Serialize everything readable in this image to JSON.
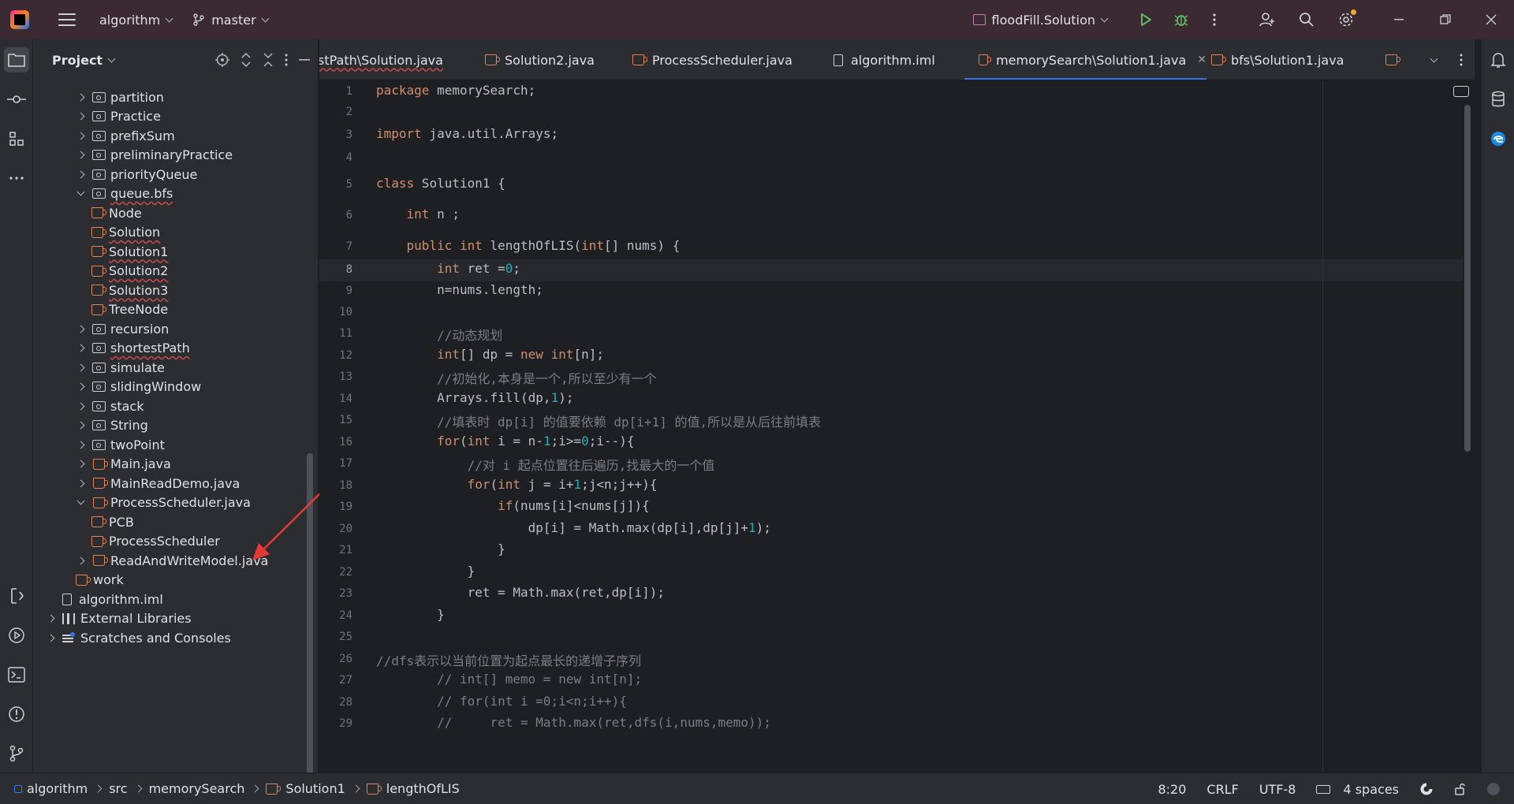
{
  "titlebar": {
    "project": "algorithm",
    "branch": "master",
    "run_config": "floodFill.Solution"
  },
  "project_panel": {
    "title": "Project",
    "tree": [
      {
        "label": "partition",
        "type": "folder",
        "depth": 1,
        "state": "collapsed",
        "error": false
      },
      {
        "label": "Practice",
        "type": "folder",
        "depth": 1,
        "state": "collapsed",
        "error": false
      },
      {
        "label": "prefixSum",
        "type": "folder",
        "depth": 1,
        "state": "collapsed",
        "error": false
      },
      {
        "label": "preliminaryPractice",
        "type": "folder",
        "depth": 1,
        "state": "collapsed",
        "error": false
      },
      {
        "label": "priorityQueue",
        "type": "folder",
        "depth": 1,
        "state": "collapsed",
        "error": false
      },
      {
        "label": "queue.bfs",
        "type": "folder",
        "depth": 1,
        "state": "expanded",
        "error": true
      },
      {
        "label": "Node",
        "type": "class",
        "depth": 2,
        "state": "leaf",
        "error": false
      },
      {
        "label": "Solution",
        "type": "class",
        "depth": 2,
        "state": "leaf",
        "error": true
      },
      {
        "label": "Solution1",
        "type": "class",
        "depth": 2,
        "state": "leaf",
        "error": true
      },
      {
        "label": "Solution2",
        "type": "class",
        "depth": 2,
        "state": "leaf",
        "error": true
      },
      {
        "label": "Solution3",
        "type": "class",
        "depth": 2,
        "state": "leaf",
        "error": true
      },
      {
        "label": "TreeNode",
        "type": "class",
        "depth": 2,
        "state": "leaf",
        "error": false
      },
      {
        "label": "recursion",
        "type": "folder",
        "depth": 1,
        "state": "collapsed",
        "error": false
      },
      {
        "label": "shortestPath",
        "type": "folder",
        "depth": 1,
        "state": "collapsed",
        "error": true
      },
      {
        "label": "simulate",
        "type": "folder",
        "depth": 1,
        "state": "collapsed",
        "error": false
      },
      {
        "label": "slidingWindow",
        "type": "folder",
        "depth": 1,
        "state": "collapsed",
        "error": false
      },
      {
        "label": "stack",
        "type": "folder",
        "depth": 1,
        "state": "collapsed",
        "error": false
      },
      {
        "label": "String",
        "type": "folder",
        "depth": 1,
        "state": "collapsed",
        "error": false
      },
      {
        "label": "twoPoint",
        "type": "folder",
        "depth": 1,
        "state": "collapsed",
        "error": false
      },
      {
        "label": "Main.java",
        "type": "class",
        "depth": 1,
        "state": "collapsed",
        "error": false
      },
      {
        "label": "MainReadDemo.java",
        "type": "class",
        "depth": 1,
        "state": "collapsed",
        "error": false
      },
      {
        "label": "ProcessScheduler.java",
        "type": "class",
        "depth": 1,
        "state": "expanded",
        "error": false
      },
      {
        "label": "PCB",
        "type": "class",
        "depth": 2,
        "state": "leaf",
        "error": false
      },
      {
        "label": "ProcessScheduler",
        "type": "class",
        "depth": 2,
        "state": "leaf",
        "error": false
      },
      {
        "label": "ReadAndWriteModel.java",
        "type": "class",
        "depth": 1,
        "state": "collapsed",
        "error": false
      },
      {
        "label": "work",
        "type": "class",
        "depth": 1,
        "state": "leaf",
        "error": false
      },
      {
        "label": "algorithm.iml",
        "type": "iml",
        "depth": 0,
        "state": "leaf",
        "error": false
      },
      {
        "label": "External Libraries",
        "type": "libs",
        "depth": -1,
        "state": "collapsed",
        "error": false
      },
      {
        "label": "Scratches and Consoles",
        "type": "scratch",
        "depth": -1,
        "state": "collapsed",
        "error": false
      }
    ]
  },
  "tabs": [
    {
      "label": "stPath\\Solution.java",
      "icon": "none",
      "active": false,
      "error": true
    },
    {
      "label": "Solution2.java",
      "icon": "class",
      "active": false,
      "error": false
    },
    {
      "label": "ProcessScheduler.java",
      "icon": "class",
      "active": false,
      "error": false
    },
    {
      "label": "algorithm.iml",
      "icon": "iml",
      "active": false,
      "error": false
    },
    {
      "label": "memorySearch\\Solution1.java",
      "icon": "class",
      "active": true,
      "error": false
    },
    {
      "label": "bfs\\Solution1.java",
      "icon": "class",
      "active": false,
      "error": false
    }
  ],
  "editor": {
    "current_line": 8,
    "lines": [
      {
        "n": "1",
        "tokens": [
          [
            "kw",
            "package"
          ],
          [
            "t",
            " memorySearch;"
          ]
        ]
      },
      {
        "n": "2",
        "tokens": []
      },
      {
        "n": "3",
        "tokens": [
          [
            "kw",
            "import"
          ],
          [
            "t",
            " java.util.Arrays;"
          ]
        ]
      },
      {
        "n": "4",
        "tokens": []
      },
      {
        "n": "5",
        "tokens": [
          [
            "kw",
            "class"
          ],
          [
            "t",
            " Solution1 {"
          ]
        ]
      },
      {
        "n": "6",
        "tokens": [
          [
            "t",
            "    "
          ],
          [
            "kw",
            "int"
          ],
          [
            "t",
            " n ;"
          ]
        ]
      },
      {
        "n": "7",
        "tokens": [
          [
            "t",
            "    "
          ],
          [
            "kw",
            "public int"
          ],
          [
            "t",
            " lengthOfLIS("
          ],
          [
            "kw",
            "int"
          ],
          [
            "t",
            "[] nums) {"
          ]
        ]
      },
      {
        "n": "8",
        "tokens": [
          [
            "t",
            "        "
          ],
          [
            "kw",
            "int"
          ],
          [
            "t",
            " ret ="
          ],
          [
            "num",
            "0"
          ],
          [
            "t",
            ";"
          ]
        ]
      },
      {
        "n": "9",
        "tokens": [
          [
            "t",
            "        n=nums.length;"
          ]
        ]
      },
      {
        "n": "10",
        "tokens": []
      },
      {
        "n": "11",
        "tokens": [
          [
            "t",
            "        "
          ],
          [
            "cm",
            "//动态规划"
          ]
        ]
      },
      {
        "n": "12",
        "tokens": [
          [
            "t",
            "        "
          ],
          [
            "kw",
            "int"
          ],
          [
            "t",
            "[] dp = "
          ],
          [
            "kw",
            "new int"
          ],
          [
            "t",
            "[n];"
          ]
        ]
      },
      {
        "n": "13",
        "tokens": [
          [
            "t",
            "        "
          ],
          [
            "cm",
            "//初始化,本身是一个,所以至少有一个"
          ]
        ]
      },
      {
        "n": "14",
        "tokens": [
          [
            "t",
            "        Arrays.fill(dp,"
          ],
          [
            "num",
            "1"
          ],
          [
            "t",
            ");"
          ]
        ]
      },
      {
        "n": "15",
        "tokens": [
          [
            "t",
            "        "
          ],
          [
            "cm",
            "//填表时 dp[i] 的值要依赖 dp[i+1] 的值,所以是从后往前填表"
          ]
        ]
      },
      {
        "n": "16",
        "tokens": [
          [
            "t",
            "        "
          ],
          [
            "kw",
            "for"
          ],
          [
            "t",
            "("
          ],
          [
            "kw",
            "int"
          ],
          [
            "t",
            " i = n-"
          ],
          [
            "num",
            "1"
          ],
          [
            "t",
            ";i>="
          ],
          [
            "num",
            "0"
          ],
          [
            "t",
            ";i--){"
          ]
        ]
      },
      {
        "n": "17",
        "tokens": [
          [
            "t",
            "            "
          ],
          [
            "cm",
            "//对 i 起点位置往后遍历,找最大的一个值"
          ]
        ]
      },
      {
        "n": "18",
        "tokens": [
          [
            "t",
            "            "
          ],
          [
            "kw",
            "for"
          ],
          [
            "t",
            "("
          ],
          [
            "kw",
            "int"
          ],
          [
            "t",
            " j = i+"
          ],
          [
            "num",
            "1"
          ],
          [
            "t",
            ";j<n;j++){"
          ]
        ]
      },
      {
        "n": "19",
        "tokens": [
          [
            "t",
            "                "
          ],
          [
            "kw",
            "if"
          ],
          [
            "t",
            "(nums[i]<nums[j]){"
          ]
        ]
      },
      {
        "n": "20",
        "tokens": [
          [
            "t",
            "                    dp[i] = Math.max(dp[i],dp[j]+"
          ],
          [
            "num",
            "1"
          ],
          [
            "t",
            ");"
          ]
        ]
      },
      {
        "n": "21",
        "tokens": [
          [
            "t",
            "                }"
          ]
        ]
      },
      {
        "n": "22",
        "tokens": [
          [
            "t",
            "            }"
          ]
        ]
      },
      {
        "n": "23",
        "tokens": [
          [
            "t",
            "            ret = Math.max(ret,dp[i]);"
          ]
        ]
      },
      {
        "n": "24",
        "tokens": [
          [
            "t",
            "        }"
          ]
        ]
      },
      {
        "n": "25",
        "tokens": []
      },
      {
        "n": "26",
        "tokens": [
          [
            "cm",
            "//dfs表示以当前位置为起点最长的递增子序列"
          ]
        ]
      },
      {
        "n": "27",
        "tokens": [
          [
            "t",
            "        "
          ],
          [
            "cm",
            "// int[] memo = new int[n];"
          ]
        ]
      },
      {
        "n": "28",
        "tokens": [
          [
            "t",
            "        "
          ],
          [
            "cm",
            "// for(int i =0;i<n;i++){"
          ]
        ]
      },
      {
        "n": "29",
        "tokens": [
          [
            "t",
            "        "
          ],
          [
            "cm",
            "//     ret = Math.max(ret,dfs(i,nums,memo));"
          ]
        ]
      }
    ]
  },
  "statusbar": {
    "breadcrumbs": [
      {
        "label": "algorithm",
        "icon": "module"
      },
      {
        "label": "src",
        "icon": "none"
      },
      {
        "label": "memorySearch",
        "icon": "none"
      },
      {
        "label": "Solution1",
        "icon": "class"
      },
      {
        "label": "lengthOfLIS",
        "icon": "method"
      }
    ],
    "position": "8:20",
    "line_sep": "CRLF",
    "encoding": "UTF-8",
    "indent": "4 spaces"
  },
  "colors": {
    "accent": "#3574f0",
    "titlebar": "#3c2a33",
    "keyword": "#cf8e6d",
    "number": "#2aacb8",
    "comment": "#7a7e85",
    "annotation_arrow": "#e53935"
  }
}
